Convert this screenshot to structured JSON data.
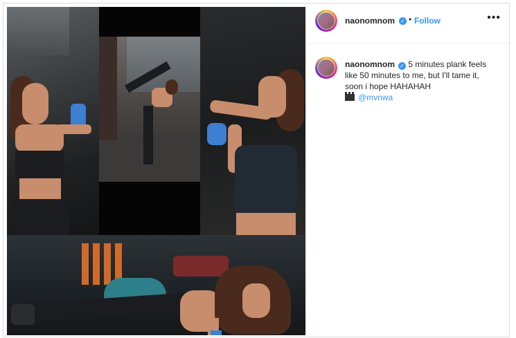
{
  "post": {
    "username": "naonomnom",
    "follow_label": "Follow",
    "separator": "•",
    "more_label": "•••",
    "verified_glyph": "✓"
  },
  "caption": {
    "username": "naonomnom",
    "text": "5 minutes plank feels like 50 minutes to me, but I'll tame it, soon i hope HAHAHAH",
    "mention": "@mvnwa",
    "mention_icon": "clapperboard-icon"
  },
  "colors": {
    "link_blue": "#3897f0",
    "text": "#262626",
    "border": "#dbdbdb"
  }
}
